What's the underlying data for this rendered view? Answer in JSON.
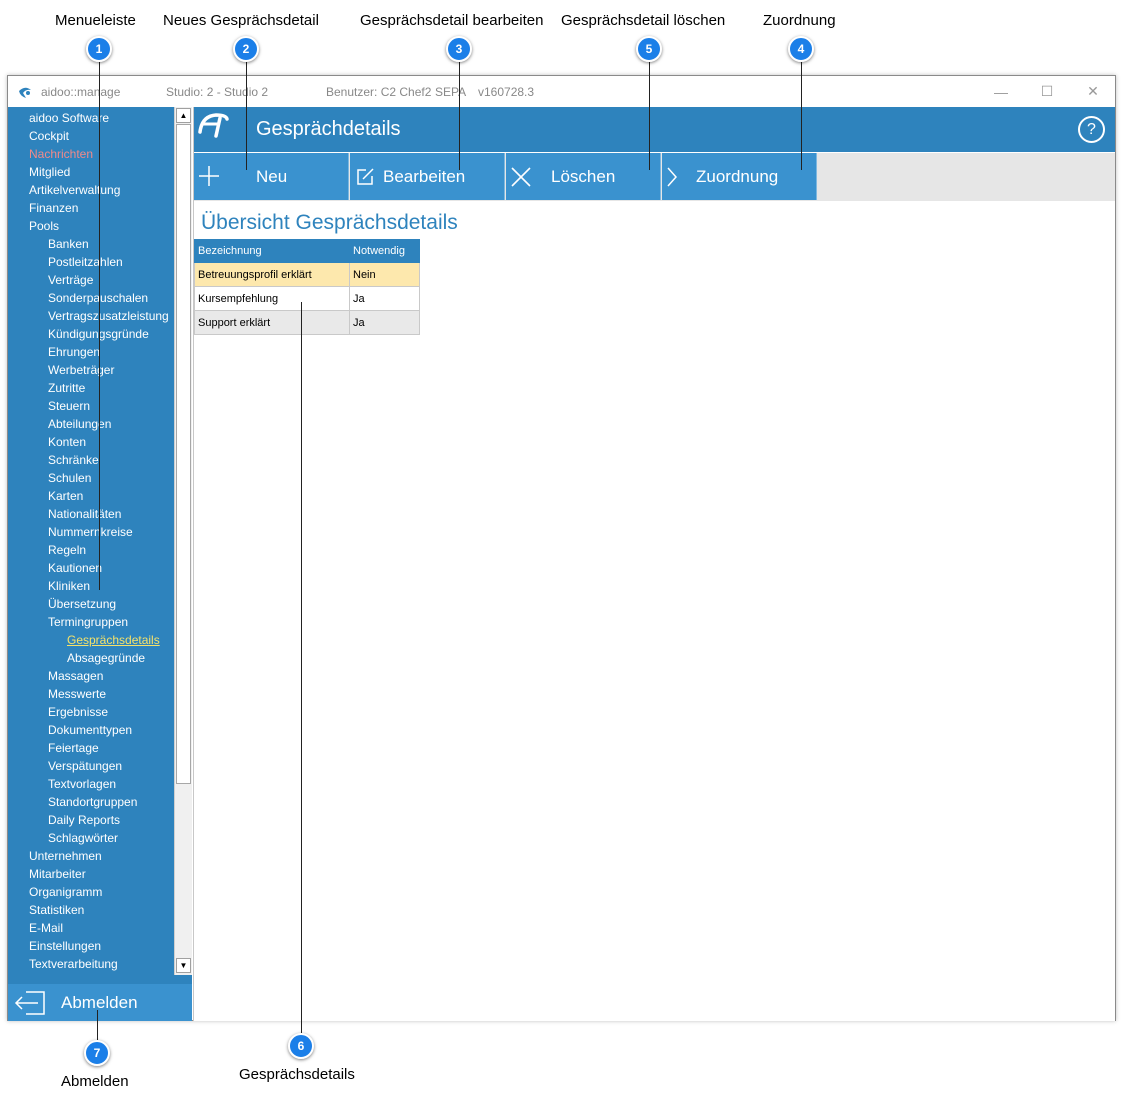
{
  "annotations": [
    {
      "num": "1",
      "label": "Menueleiste"
    },
    {
      "num": "2",
      "label": "Neues Gesprächsdetail"
    },
    {
      "num": "3",
      "label": "Gesprächsdetail bearbeiten"
    },
    {
      "num": "5",
      "label": "Gesprächsdetail löschen"
    },
    {
      "num": "4",
      "label": "Zuordnung"
    },
    {
      "num": "6",
      "label": "Gesprächsdetails"
    },
    {
      "num": "7",
      "label": "Abmelden"
    }
  ],
  "titlebar": {
    "app": "aidoo::manage",
    "studio": "Studio: 2 - Studio 2",
    "user": "Benutzer: C2 Chef2",
    "sepa": "SEPA",
    "version": "v160728.3"
  },
  "window_controls": {
    "minimize": "—",
    "maximize": "☐",
    "close": "✕"
  },
  "menu": [
    {
      "label": "aidoo Software",
      "level": 0
    },
    {
      "label": "Cockpit",
      "level": 0
    },
    {
      "label": "Nachrichten",
      "level": 0,
      "color": "#f08a8a"
    },
    {
      "label": "Mitglied",
      "level": 0
    },
    {
      "label": "Artikelverwaltung",
      "level": 0
    },
    {
      "label": "Finanzen",
      "level": 0
    },
    {
      "label": "Pools",
      "level": 0
    },
    {
      "label": "Banken",
      "level": 1
    },
    {
      "label": "Postleitzahlen",
      "level": 1
    },
    {
      "label": "Verträge",
      "level": 1
    },
    {
      "label": "Sonderpauschalen",
      "level": 1
    },
    {
      "label": "Vertragszusatzleistung",
      "level": 1
    },
    {
      "label": "Kündigungsgründe",
      "level": 1
    },
    {
      "label": "Ehrungen",
      "level": 1
    },
    {
      "label": "Werbeträger",
      "level": 1
    },
    {
      "label": "Zutritte",
      "level": 1
    },
    {
      "label": "Steuern",
      "level": 1
    },
    {
      "label": "Abteilungen",
      "level": 1
    },
    {
      "label": "Konten",
      "level": 1
    },
    {
      "label": "Schränke",
      "level": 1
    },
    {
      "label": "Schulen",
      "level": 1
    },
    {
      "label": "Karten",
      "level": 1
    },
    {
      "label": "Nationalitäten",
      "level": 1
    },
    {
      "label": "Nummernkreise",
      "level": 1
    },
    {
      "label": "Regeln",
      "level": 1
    },
    {
      "label": "Kautionen",
      "level": 1
    },
    {
      "label": "Kliniken",
      "level": 1
    },
    {
      "label": "Übersetzung",
      "level": 1
    },
    {
      "label": "Termingruppen",
      "level": 1
    },
    {
      "label": "Gesprächsdetails",
      "level": 2,
      "active": true
    },
    {
      "label": "Absagegründe",
      "level": 2
    },
    {
      "label": "Massagen",
      "level": 1
    },
    {
      "label": "Messwerte",
      "level": 1
    },
    {
      "label": "Ergebnisse",
      "level": 1
    },
    {
      "label": "Dokumenttypen",
      "level": 1
    },
    {
      "label": "Feiertage",
      "level": 1
    },
    {
      "label": "Verspätungen",
      "level": 1
    },
    {
      "label": "Textvorlagen",
      "level": 1
    },
    {
      "label": "Standortgruppen",
      "level": 1
    },
    {
      "label": "Daily Reports",
      "level": 1
    },
    {
      "label": "Schlagwörter",
      "level": 1
    },
    {
      "label": "Unternehmen",
      "level": 0
    },
    {
      "label": "Mitarbeiter",
      "level": 0
    },
    {
      "label": "Organigramm",
      "level": 0
    },
    {
      "label": "Statistiken",
      "level": 0
    },
    {
      "label": "E-Mail",
      "level": 0
    },
    {
      "label": "Einstellungen",
      "level": 0
    },
    {
      "label": "Textverarbeitung",
      "level": 0
    }
  ],
  "logout": {
    "label": "Abmelden",
    "icon": "arrow-left-icon"
  },
  "header": {
    "title": "Gesprächdetails",
    "help": "?"
  },
  "toolbar": {
    "new": "Neu",
    "edit": "Bearbeiten",
    "delete": "Löschen",
    "assign": "Zuordnung"
  },
  "section": {
    "title": "Übersicht Gesprächsdetails"
  },
  "table": {
    "columns": [
      "Bezeichnung",
      "Notwendig"
    ],
    "rows": [
      [
        "Betreuungsprofil erklärt",
        "Nein"
      ],
      [
        "Kursempfehlung",
        "Ja"
      ],
      [
        "Support erklärt",
        "Ja"
      ]
    ]
  },
  "colors": {
    "accent": "#2e83bd",
    "button": "#3a92cf",
    "selected_row": "#fde8ad",
    "badge": "#1b7fe8",
    "active_menu": "#f5e26a"
  }
}
